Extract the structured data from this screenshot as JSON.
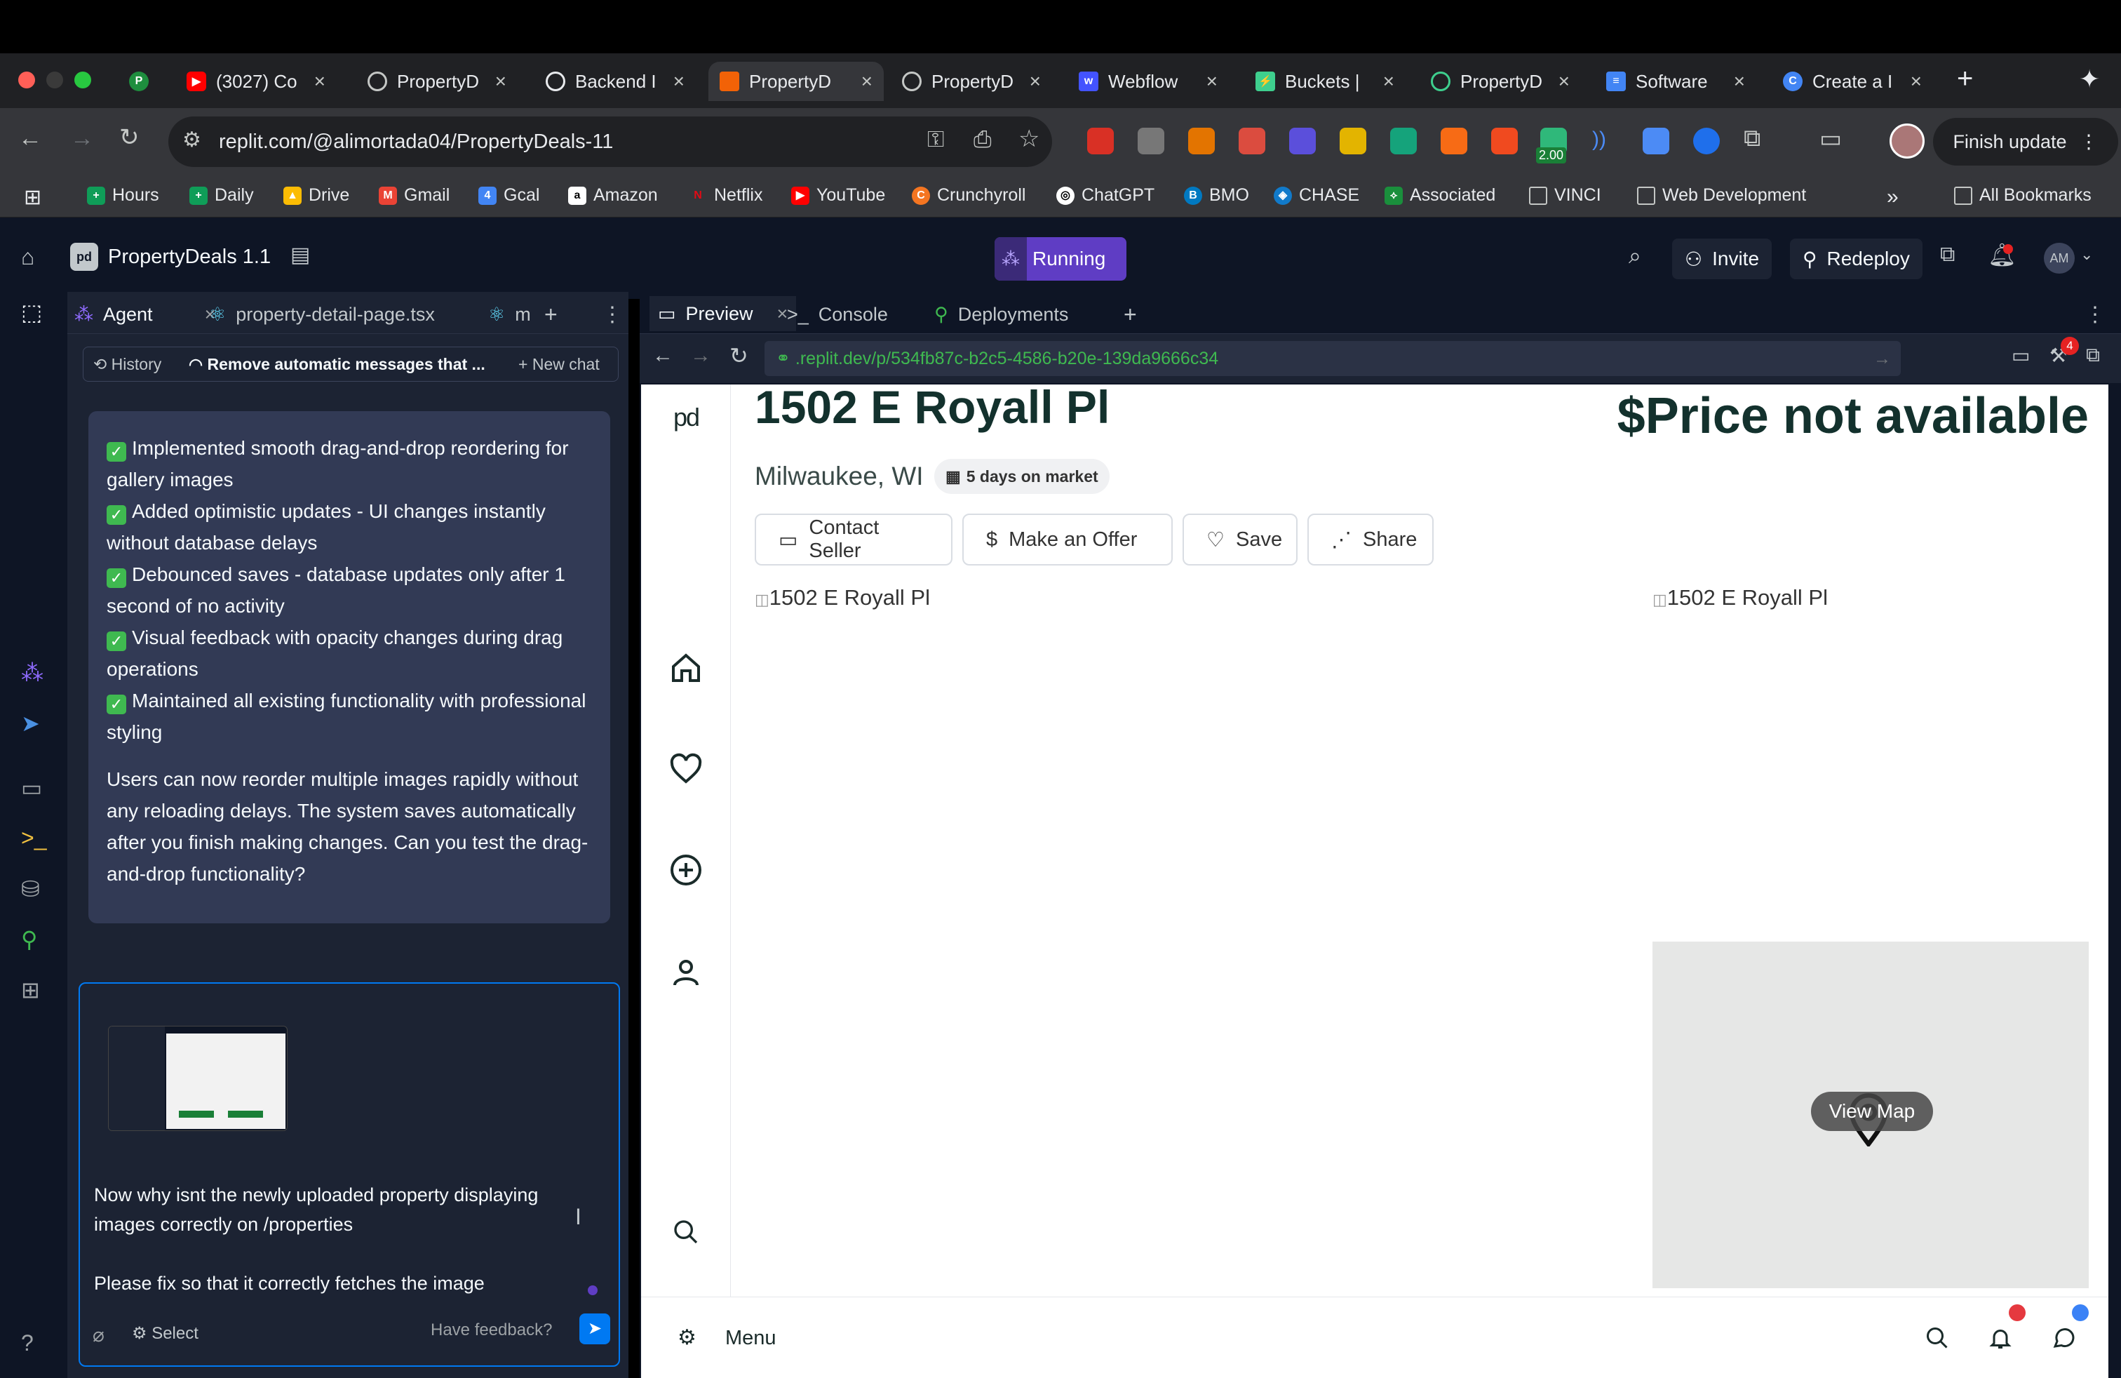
{
  "browser": {
    "tabs": [
      {
        "title": "",
        "icon": "P",
        "color": "#1e8e3e"
      },
      {
        "title": "(3027) Co",
        "icon": "youtube",
        "color": "#ff0000"
      },
      {
        "title": "PropertyD",
        "icon": "globe",
        "color": "#9aa0a6"
      },
      {
        "title": "Backend I",
        "icon": "openai",
        "color": "#9aa0a6"
      },
      {
        "title": "PropertyD",
        "icon": "replit",
        "color": "#f26207",
        "active": true
      },
      {
        "title": "PropertyD",
        "icon": "globe",
        "color": "#9aa0a6"
      },
      {
        "title": "Webflow",
        "icon": "webflow",
        "color": "#4353ff"
      },
      {
        "title": "Buckets |",
        "icon": "supabase",
        "color": "#3ecf8e"
      },
      {
        "title": "PropertyD",
        "icon": "supabase",
        "color": "#3ecf8e"
      },
      {
        "title": "Software",
        "icon": "docs",
        "color": "#4285f4"
      },
      {
        "title": "Create a I",
        "icon": "chrome",
        "color": "#4285f4"
      }
    ],
    "url": "replit.com/@alimortada04/PropertyDeals-11",
    "finish_update": "Finish update",
    "ext_badge": "2.00",
    "bookmarks": [
      "Hours",
      "Daily",
      "Drive",
      "Gmail",
      "Gcal",
      "Amazon",
      "Netflix",
      "YouTube",
      "Crunchyroll",
      "ChatGPT",
      "BMO",
      "CHASE",
      "Associated",
      "VINCI",
      "Web Development"
    ],
    "all_bookmarks": "All Bookmarks",
    "colors": {
      "chrome_dark": "#202124",
      "chrome_mid": "#35363a"
    }
  },
  "replit": {
    "project_name": "PropertyDeals 1.1",
    "status": "Running",
    "invite": "Invite",
    "redeploy": "Redeploy",
    "avatar": "AM",
    "left_tabs": {
      "agent": "Agent",
      "file": "property-detail-page.tsx",
      "third": "m"
    },
    "history": "History",
    "chat_title": "Remove automatic messages that ...",
    "new_chat": "New chat",
    "message": {
      "items": [
        "Implemented smooth drag-and-drop reordering for gallery images",
        "Added optimistic updates - UI changes instantly without database delays",
        "Debounced saves - database updates only after 1 second of no activity",
        "Visual feedback with opacity changes during drag operations",
        "Maintained all existing functionality with professional styling"
      ],
      "summary": "Users can now reorder multiple images rapidly without any reloading delays. The system saves automatically after you finish making changes. Can you test the drag-and-drop functionality?"
    },
    "input": {
      "line1": "Now why isnt the newly uploaded property displaying images correctly on /properties",
      "line2": "Please fix so that it correctly fetches the image",
      "select": "Select",
      "feedback": "Have feedback?"
    },
    "right_tabs": {
      "preview": "Preview",
      "console": "Console",
      "deployments": "Deployments"
    },
    "preview_url": ".replit.dev/p/534fb87c-b2c5-4586-b20e-139da9666c34",
    "notif_count": "4",
    "accent": "#5f3dc4"
  },
  "property": {
    "logo": "pd",
    "address": "1502 E Royall Pl",
    "city": "Milwaukee, WI",
    "days": "5 days on market",
    "price": "$Price not available",
    "buttons": {
      "contact": "Contact Seller",
      "offer": "Make an Offer",
      "save": "Save",
      "share": "Share"
    },
    "img_alt_main": "1502 E Royall Pl",
    "img_alt_side": "1502 E Royall Pl",
    "view_map": "View Map",
    "menu": "Menu"
  }
}
